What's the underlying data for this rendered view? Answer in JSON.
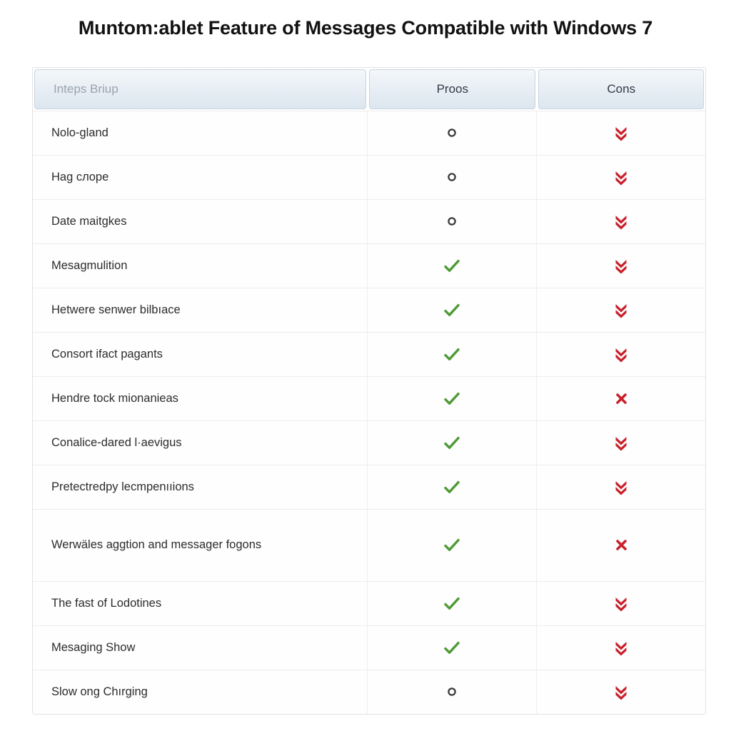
{
  "title": "Muntom:ablet Feature of Messages Compatible with Windows 7",
  "colors": {
    "check_green": "#4e9a35",
    "cons_red": "#c9202b",
    "circle_gray": "#3a3a3a",
    "header_text": "#333a42",
    "header_muted": "#9aa3ac"
  },
  "table": {
    "headers": {
      "feature": "Inteps Briup",
      "pros": "Proos",
      "cons": "Cons"
    },
    "rows": [
      {
        "feature": "Nolo-gland",
        "pros": "circle",
        "cons": "double-chevron-down",
        "tall": false
      },
      {
        "feature": "Hag cлope",
        "pros": "circle",
        "cons": "double-chevron-down",
        "tall": false
      },
      {
        "feature": "Date maitgkes",
        "pros": "circle",
        "cons": "double-chevron-down",
        "tall": false
      },
      {
        "feature": "Mesagmulition",
        "pros": "check",
        "cons": "double-chevron-down",
        "tall": false
      },
      {
        "feature": "Hetwere senwer bilbıace",
        "pros": "check",
        "cons": "double-chevron-down",
        "tall": false
      },
      {
        "feature": "Consort ifact pagants",
        "pros": "check",
        "cons": "double-chevron-down",
        "tall": false
      },
      {
        "feature": "Hendre tock mionanieas",
        "pros": "check",
        "cons": "cross",
        "tall": false
      },
      {
        "feature": "Conаlice-dared l·aevigus",
        "pros": "check",
        "cons": "double-chevron-down",
        "tall": false
      },
      {
        "feature": "Pretectredpy lecmpenııions",
        "pros": "check",
        "cons": "double-chevron-down",
        "tall": false
      },
      {
        "feature": "Werwäles aggtion and messager fogons",
        "pros": "check",
        "cons": "cross",
        "tall": true
      },
      {
        "feature": "The fast of Lodotines",
        "pros": "check",
        "cons": "double-chevron-down",
        "tall": false
      },
      {
        "feature": "Mesaging Show",
        "pros": "check",
        "cons": "double-chevron-down",
        "tall": false
      },
      {
        "feature": "Slow ong Chırging",
        "pros": "circle",
        "cons": "double-chevron-down",
        "tall": false
      }
    ]
  }
}
